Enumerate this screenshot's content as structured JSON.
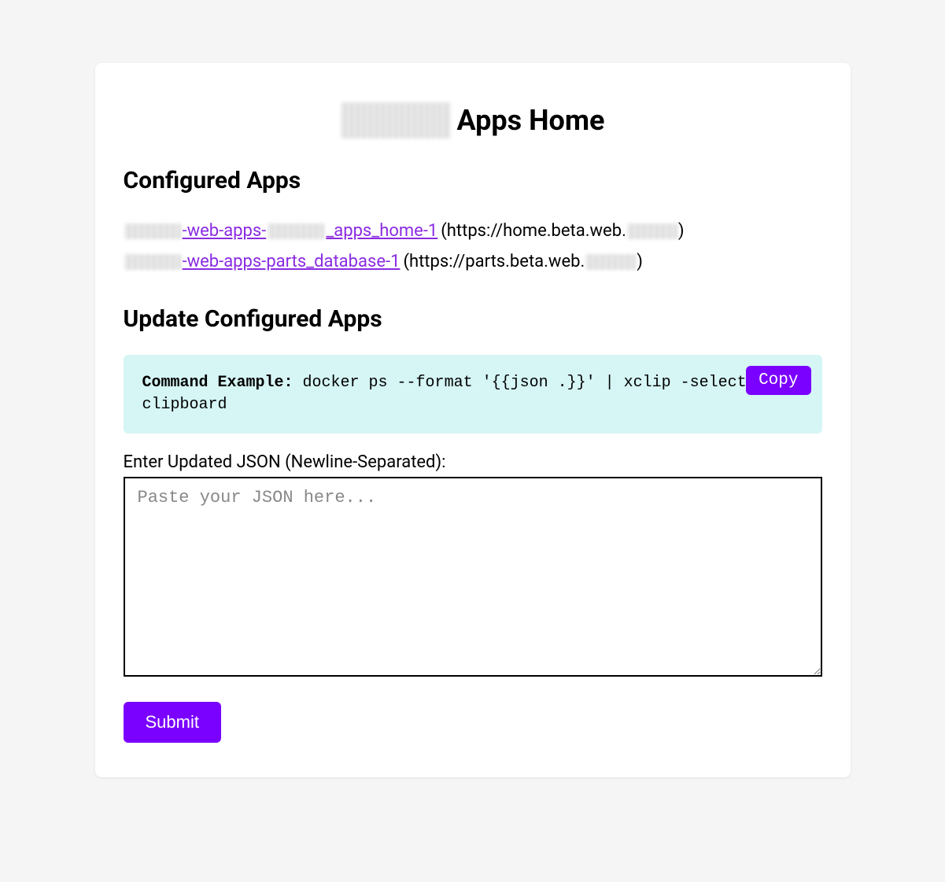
{
  "header": {
    "title_suffix": "Apps Home"
  },
  "sections": {
    "configured_heading": "Configured Apps",
    "update_heading": "Update Configured Apps"
  },
  "apps": [
    {
      "link_middle": "-web-apps-",
      "link_suffix": "_apps_home-1",
      "url_prefix": " (https://home.beta.web.",
      "url_suffix": ")"
    },
    {
      "link_middle": "-web-apps-parts_database-1",
      "link_suffix": "",
      "url_prefix": " (https://parts.beta.web.",
      "url_suffix": ")"
    }
  ],
  "command_box": {
    "label": "Command Example:",
    "command": " docker ps --format '{{json .}}' | xclip -selection clipboard",
    "copy_label": "Copy"
  },
  "form": {
    "textarea_label": "Enter Updated JSON (Newline-Separated):",
    "textarea_placeholder": "Paste your JSON here...",
    "submit_label": "Submit"
  }
}
